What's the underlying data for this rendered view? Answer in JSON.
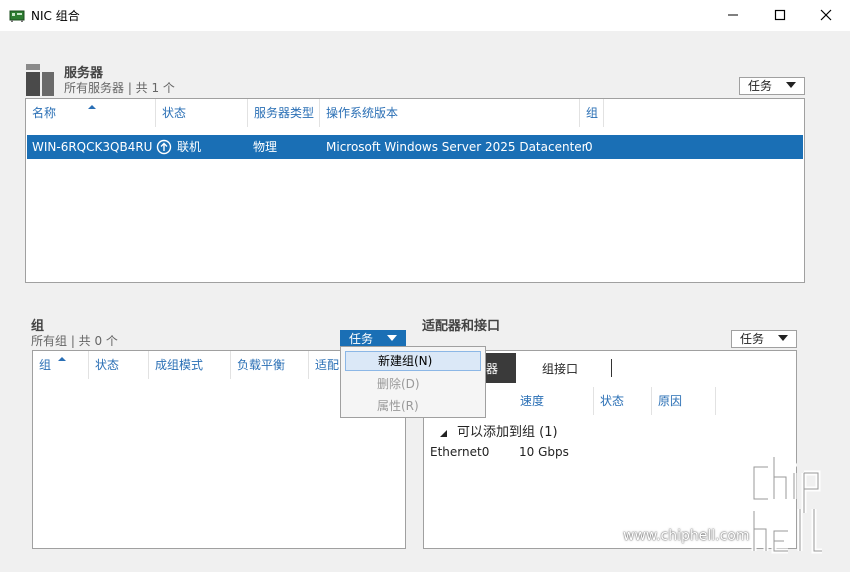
{
  "window": {
    "title": "NIC 组合",
    "minimize_glyph": "—",
    "maximize_glyph": "☐",
    "close_glyph": "✕"
  },
  "servers": {
    "title": "服务器",
    "subtitle": "所有服务器 | 共 1 个",
    "task_label": "任务",
    "columns": [
      "名称",
      "状态",
      "服务器类型",
      "操作系统版本",
      "组"
    ],
    "rows": [
      {
        "name": "WIN-6RQCK3QB4RU",
        "status": "联机",
        "type": "物理",
        "os": "Microsoft Windows Server 2025 Datacenter",
        "groups": "0"
      }
    ]
  },
  "teams": {
    "title": "组",
    "subtitle": "所有组 | 共 0 个",
    "task_label": "任务",
    "columns": [
      "组",
      "状态",
      "成组模式",
      "负载平衡",
      "适配"
    ]
  },
  "task_menu": {
    "items": [
      {
        "label": "新建组(N)",
        "enabled": true
      },
      {
        "label": "删除(D)",
        "enabled": false
      },
      {
        "label": "属性(R)",
        "enabled": false
      }
    ]
  },
  "adapters": {
    "title": "适配器和接口",
    "task_label": "任务",
    "tabs": [
      "网络适配器",
      "组接口"
    ],
    "tab_visible_fragment": "器",
    "columns": [
      "速度",
      "状态",
      "原因"
    ],
    "group_header": "可以添加到组 (1)",
    "rows": [
      {
        "name": "Ethernet0",
        "speed": "10 Gbps"
      }
    ]
  },
  "watermark": {
    "text": "www.chiphell.com",
    "logo_text": "chip hell"
  },
  "colors": {
    "accent": "#1a6fb5",
    "header_text": "#2a6fb5"
  }
}
